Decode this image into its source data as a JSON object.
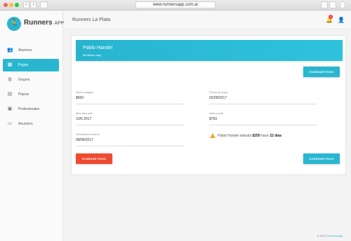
{
  "browser": {
    "url": "www.runnersapp.com.ar",
    "back_glyph": "‹",
    "forward_glyph": "›"
  },
  "brand": {
    "name": "Runners",
    "suffix": "APP",
    "logo_icon": "runner-icon",
    "color": "#29b6d1"
  },
  "sidebar": {
    "items": [
      {
        "label": "Alumnos",
        "icon": "users-icon",
        "glyph": "👥",
        "active": false
      },
      {
        "label": "Pagos",
        "icon": "calendar-icon",
        "glyph": "▦",
        "active": true
      },
      {
        "label": "Grupos",
        "icon": "globe-icon",
        "glyph": "◍",
        "active": false
      },
      {
        "label": "Planes",
        "icon": "clipboard-icon",
        "glyph": "▤",
        "active": false
      },
      {
        "label": "Profesionales",
        "icon": "briefcase-icon",
        "glyph": "▣",
        "active": false
      },
      {
        "label": "Anuncios",
        "icon": "message-icon",
        "glyph": "▭",
        "active": false
      }
    ]
  },
  "header": {
    "title": "Runners La Plata",
    "notifications_count": "2",
    "bell_icon": "bell-icon",
    "user_icon": "user-icon"
  },
  "card": {
    "student_name": "Pablo Handel",
    "subtitle": "Modificar pago",
    "save_label": "GUARDAR PAGO",
    "delete_label": "ELIMINAR PAGO",
    "fields": {
      "monto_label": "Monto pagado",
      "monto_value": "$500",
      "fecha_label": "Fecha de pago",
      "fecha_value": "02/09/2017",
      "mes_label": "Mes abonado",
      "mes_value": "JUN 2017",
      "valor_label": "Valor cuota",
      "valor_value": "$750",
      "venc_label": "Vencimiento actual",
      "venc_value": "08/06/2017"
    },
    "warning": {
      "prefix": "Pablo Handel adeuda",
      "amount": "$250",
      "middle": "hace",
      "days": "22 días",
      "color": "#f5a623"
    }
  },
  "footer": {
    "copyright": "© 2017",
    "link": "RunnersApp"
  }
}
